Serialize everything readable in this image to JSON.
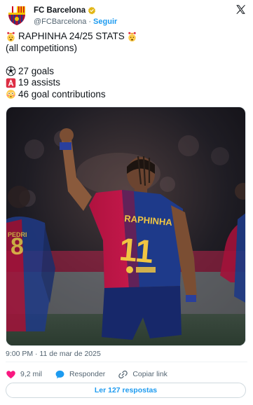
{
  "account": {
    "display_name": "FC Barcelona",
    "handle": "@FCBarcelona",
    "separator": "·",
    "follow_label": "Seguir",
    "avatar_icon": "fc-barcelona-crest-icon",
    "verified_icon": "verified-badge-icon",
    "verified_color": "#e2b719",
    "logo_icon": "x-logo-icon"
  },
  "tweet": {
    "line1": "RAPHINHA 24/25 STATS",
    "line2": "(all competitions)",
    "stat_goals": "27 goals",
    "stat_assists": "19 assists",
    "stat_contributions": "46 goal contributions",
    "icons": [
      "exploding-head-icon",
      "soccer-ball-icon",
      "letter-a-icon",
      "flushed-face-icon"
    ]
  },
  "photo": {
    "description_icon": "raphinha-celebrating-photo",
    "jersey_name": "RAPHINHA",
    "jersey_number": "11",
    "left_player_number": "8",
    "left_player_name": "PEDRI"
  },
  "timestamp": "9:00 PM · 11 de mar de 2025",
  "actions": {
    "likes": "9,2 mil",
    "reply_label": "Responder",
    "copy_label": "Copiar link"
  },
  "read_replies_label": "Ler 127 respostas",
  "colors": {
    "accent": "#1d9bf0",
    "like": "#f91880",
    "text": "#0f1419",
    "muted": "#536471",
    "barca_blue": "#1e3a8a",
    "barca_red": "#a3123a"
  }
}
